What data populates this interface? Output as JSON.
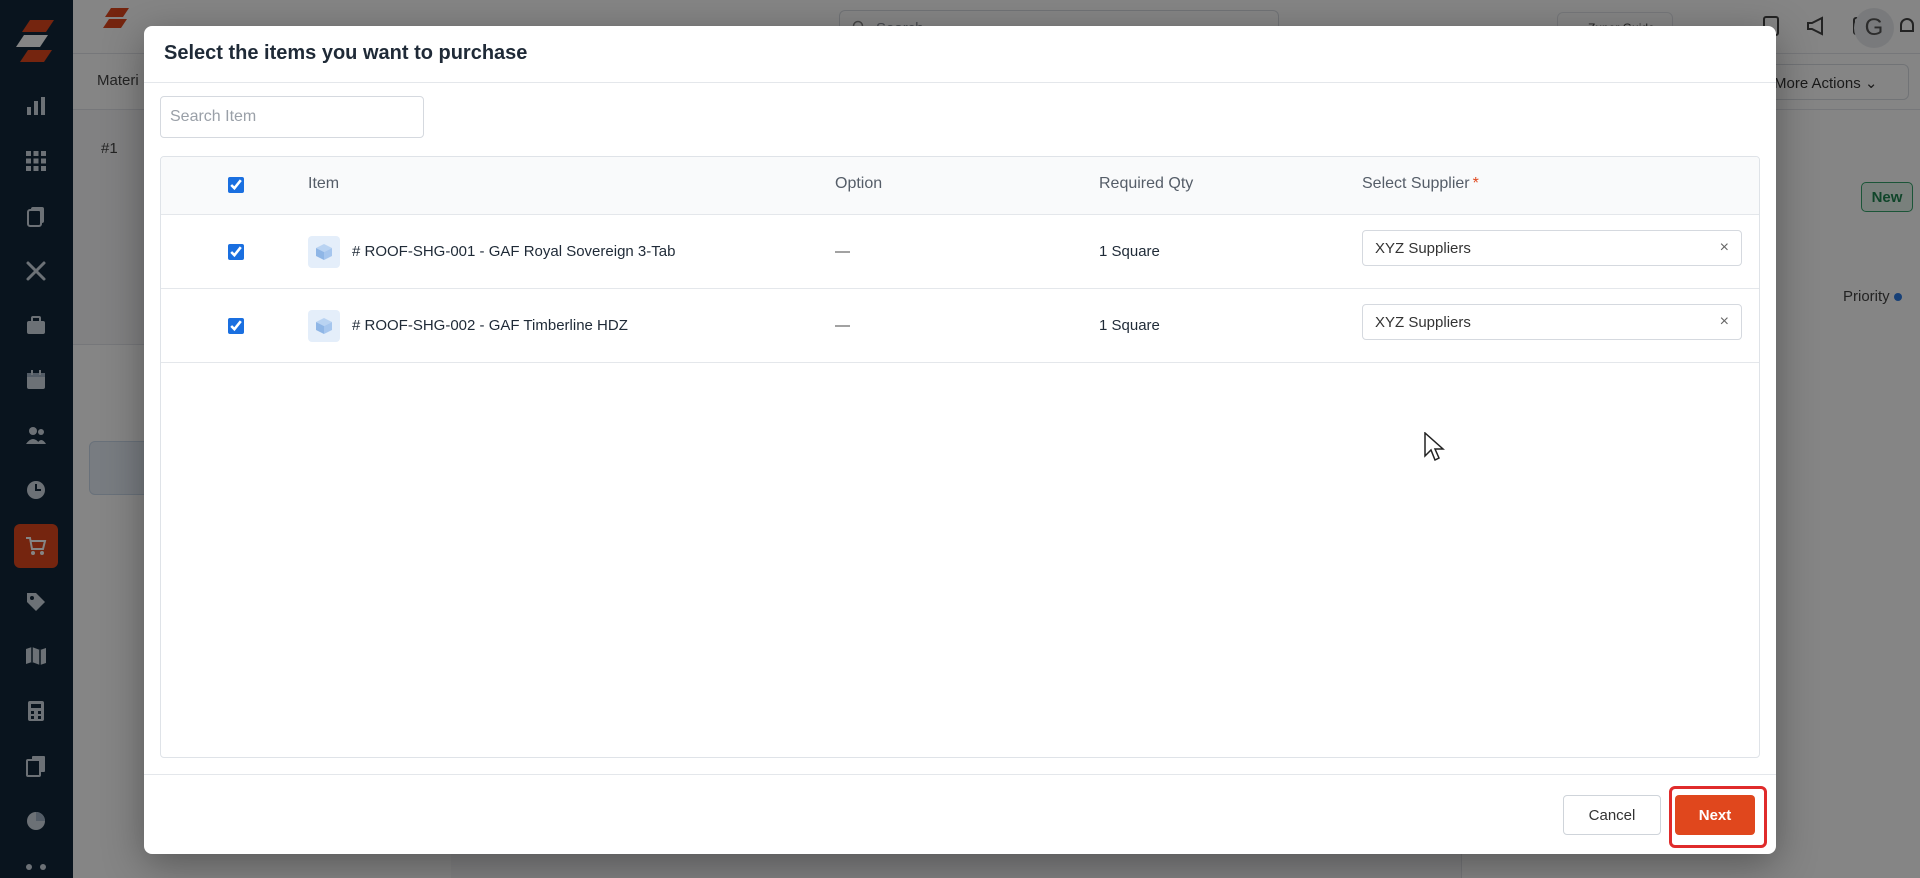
{
  "background_app": {
    "search_placeholder": "Search",
    "guide_label": "Zuper Guide",
    "user_initial": "G",
    "section_tab": "Materi",
    "more_actions_label": "More Actions",
    "record_number": "#1",
    "status_badge": "New",
    "priority_label": "Priority"
  },
  "modal": {
    "title": "Select the items you want to purchase",
    "search_placeholder": "Search Item",
    "columns": {
      "item": "Item",
      "option": "Option",
      "required_qty": "Required Qty",
      "select_supplier": "Select Supplier",
      "required_marker": "*"
    },
    "rows": [
      {
        "checked": true,
        "item": "# ROOF-SHG-001 - GAF Royal Sovereign 3-Tab",
        "option": "—",
        "required_qty": "1 Square",
        "supplier": "XYZ Suppliers"
      },
      {
        "checked": true,
        "item": "# ROOF-SHG-002 - GAF Timberline HDZ",
        "option": "—",
        "required_qty": "1 Square",
        "supplier": "XYZ Suppliers"
      }
    ],
    "clear_symbol": "×",
    "cancel_label": "Cancel",
    "next_label": "Next"
  },
  "colors": {
    "nav_background": "#12283a",
    "brand_orange": "#e0471d",
    "checkbox_blue": "#1a6fe0",
    "highlight_red": "#e02b2b",
    "badge_green": "#208552"
  },
  "icons": {
    "nav": [
      "chart-icon",
      "grid-icon",
      "clipboard-icon",
      "tools-icon",
      "briefcase-icon",
      "calendar-icon",
      "users-icon",
      "clock-icon",
      "cart-icon",
      "tag-icon",
      "map-icon",
      "calculator-icon",
      "documents-icon",
      "pie-chart-icon",
      "hierarchy-icon"
    ],
    "item": "box-icon"
  }
}
